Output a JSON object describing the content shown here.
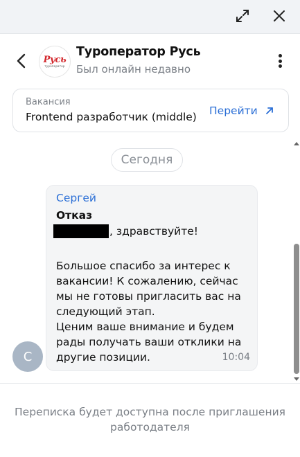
{
  "window": {
    "expand_icon": "expand-diagonal-icon",
    "close_icon": "close-icon"
  },
  "header": {
    "company_name": "Туроператор Русь",
    "status": "Был онлайн недавно",
    "logo_text": "Русь",
    "logo_subtext": "туроператор"
  },
  "vacancy": {
    "label": "Вакансия",
    "title": "Frontend разработчик (middle)",
    "action_label": "Перейти"
  },
  "chat": {
    "date_chip": "Сегодня",
    "message": {
      "avatar_letter": "С",
      "sender": "Сергей",
      "subject": "Отказ",
      "greeting": ", здравствуйте!",
      "body_lines": [
        "Большое спасибо за интерес к вакансии! К сожалению, сейчас мы не готовы пригласить вас на следующий этап.",
        "Ценим ваше внимание и будем рады получать ваши отклики на другие позиции."
      ],
      "time": "10:04"
    }
  },
  "footer": {
    "note": "Переписка будет доступна после приглашения работодателя"
  },
  "colors": {
    "accent": "#2b6fd6",
    "muted_text": "#7a7f86",
    "topbar_bg": "#f1f3f6",
    "bubble_bg": "#f4f5f6",
    "avatar_bg": "#a9b6c5",
    "logo_red": "#d3262b"
  }
}
